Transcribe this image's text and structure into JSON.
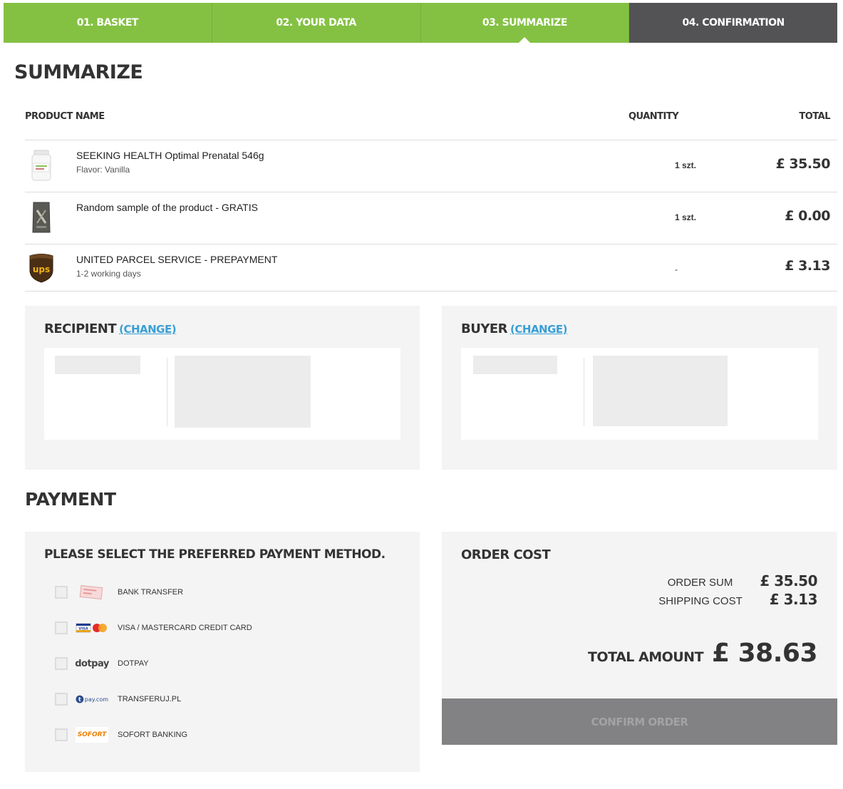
{
  "steps": [
    {
      "label": "01. BASKET"
    },
    {
      "label": "02. YOUR DATA"
    },
    {
      "label": "03. SUMMARIZE"
    },
    {
      "label": "04. CONFIRMATION"
    }
  ],
  "page_title": "SUMMARIZE",
  "table": {
    "headers": {
      "name": "PRODUCT NAME",
      "quantity": "QUANTITY",
      "total": "TOTAL"
    },
    "rows": [
      {
        "name": "SEEKING HEALTH Optimal Prenatal 546g",
        "sub": "Flavor: Vanilla",
        "qty": "1 szt.",
        "total": "£ 35.50",
        "icon": "supplement-jar-icon"
      },
      {
        "name": "Random sample of the product - GRATIS",
        "sub": "",
        "qty": "1 szt.",
        "total": "£ 0.00",
        "icon": "sample-pack-icon"
      },
      {
        "name": "UNITED PARCEL SERVICE - PREPAYMENT",
        "sub": "1-2 working days",
        "qty": "-",
        "total": "£ 3.13",
        "icon": "ups-logo-icon"
      }
    ]
  },
  "recipient": {
    "title": "RECIPIENT",
    "change": "(CHANGE)"
  },
  "buyer": {
    "title": "BUYER",
    "change": "(CHANGE)"
  },
  "payment": {
    "title": "PAYMENT",
    "prompt": "PLEASE SELECT THE PREFERRED PAYMENT METHOD.",
    "methods": [
      {
        "label": "BANK TRANSFER",
        "icon": "bank-transfer-icon"
      },
      {
        "label": "VISA / MASTERCARD CREDIT CARD",
        "icon": "credit-card-icon"
      },
      {
        "label": "DOTPAY",
        "icon": "dotpay-logo"
      },
      {
        "label": "TRANSFERUJ.PL",
        "icon": "transferuj-logo"
      },
      {
        "label": "SOFORT BANKING",
        "icon": "sofort-logo"
      }
    ]
  },
  "order_cost": {
    "title": "ORDER COST",
    "order_sum_label": "ORDER SUM",
    "order_sum": "£ 35.50",
    "shipping_label": "SHIPPING COST",
    "shipping": "£ 3.13",
    "total_label": "TOTAL AMOUNT",
    "total": "£ 38.63",
    "confirm": "CONFIRM ORDER"
  },
  "logos": {
    "dotpay": "dotpay",
    "transferuj": "pay.com",
    "sofort": "SOFORT"
  },
  "colors": {
    "green": "#84c143",
    "dark": "#535355",
    "link": "#3a9fd6",
    "panel": "#f4f4f4",
    "button": "#828285"
  }
}
